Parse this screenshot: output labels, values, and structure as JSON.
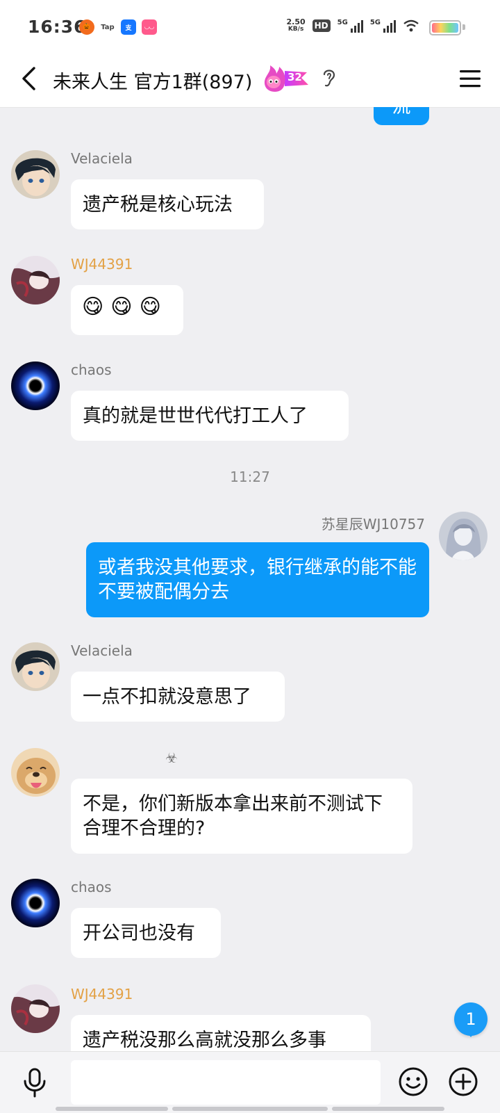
{
  "status_bar": {
    "time": "16:36",
    "net_speed_value": "2.50",
    "net_speed_unit": "KB/s",
    "hd_label": "HD",
    "sim1_label": "5G",
    "sim2_label": "5G",
    "app_icons": [
      "app-icon-orange",
      "app-icon-tap",
      "app-icon-alipay",
      "app-icon-pink"
    ]
  },
  "header": {
    "title": "未来人生 官方1群(897)",
    "level_badge": "32",
    "icons": [
      "back-icon",
      "flame-level-badge",
      "ear-icon",
      "menu-icon"
    ]
  },
  "messages": [
    {
      "type": "outgoing_partial",
      "text": "流"
    },
    {
      "type": "incoming",
      "sender": "Velaciela",
      "name_color": "#888888",
      "avatar": "avatar-anime-boy",
      "text": "遗产税是核心玩法"
    },
    {
      "type": "incoming",
      "sender": "WJ44391",
      "name_color": "#e3a145",
      "avatar": "avatar-anime-girl",
      "emojis": [
        "😋",
        "😋",
        "😋"
      ]
    },
    {
      "type": "incoming",
      "sender": "chaos",
      "name_color": "#888888",
      "avatar": "avatar-blue-ring",
      "text": "真的就是世世代代打工人了"
    },
    {
      "type": "time",
      "text": "11:27"
    },
    {
      "type": "outgoing",
      "sender": "苏星辰WJ10757",
      "avatar": "avatar-anime-silver",
      "text": "或者我没其他要求，银行继承的能不能不要被配偶分去"
    },
    {
      "type": "incoming",
      "sender": "Velaciela",
      "name_color": "#888888",
      "avatar": "avatar-anime-boy",
      "text": "一点不扣就没意思了"
    },
    {
      "type": "incoming",
      "sender": "☣",
      "name_color": "#888888",
      "avatar": "avatar-dog",
      "text": "不是，你们新版本拿出来前不测试下合理不合理的?"
    },
    {
      "type": "incoming",
      "sender": "chaos",
      "name_color": "#888888",
      "avatar": "avatar-blue-ring",
      "text": "开公司也没有"
    },
    {
      "type": "incoming",
      "sender": "WJ44391",
      "name_color": "#e3a145",
      "avatar": "avatar-anime-girl",
      "text": "遗产税没那么高就没那么多事"
    }
  ],
  "unread_count": "1",
  "input": {
    "placeholder": "",
    "value": ""
  },
  "colors": {
    "background": "#efeff2",
    "bubble_outgoing": "#0c99f9",
    "bubble_incoming": "#ffffff",
    "badge": "#1a9cf7",
    "name_highlight": "#e3a145"
  }
}
